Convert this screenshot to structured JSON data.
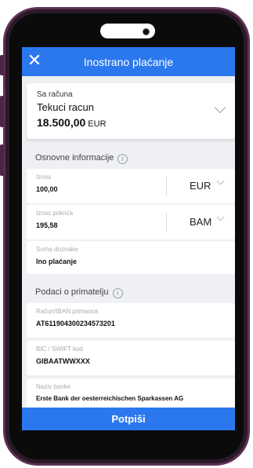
{
  "header": {
    "title": "Inostrano plaćanje",
    "close_icon": "close-icon"
  },
  "account": {
    "label": "Sa računa",
    "name": "Tekuci racun",
    "amount": "18.500,00",
    "currency": "EUR"
  },
  "basic_info": {
    "section_label": "Osnovne informacije",
    "amount": {
      "label": "Iznos",
      "value": "100,00",
      "currency": "EUR"
    },
    "coverage_amount": {
      "label": "Iznos pokrića",
      "value": "195,58",
      "currency": "BAM"
    },
    "purpose": {
      "label": "Svrha doznake",
      "value": "Ino plaćanje"
    }
  },
  "recipient": {
    "section_label": "Podaci o primatelju",
    "iban": {
      "label": "Račun/IBAN primaoca",
      "value": "AT611904300234573201"
    },
    "bic": {
      "label": "BIC / SWIFT kod",
      "value": "GIBAATWWXXX"
    },
    "bank": {
      "label": "Naziv banke",
      "value": "Erste Bank der oesterreichischen Sparkassen AG"
    }
  },
  "sign_button": "Potpiši",
  "colors": {
    "accent": "#2b78ee",
    "frame": "#5e2f55",
    "screen_bg": "#eef0f3"
  }
}
